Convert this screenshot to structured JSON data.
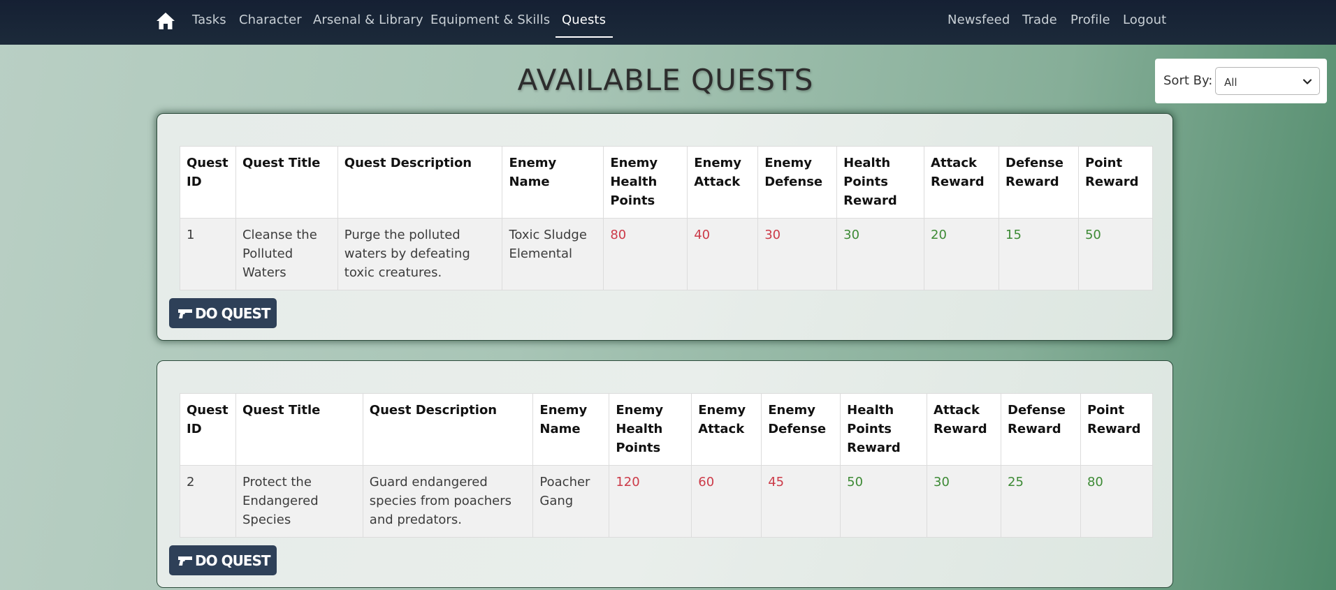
{
  "nav": {
    "left": [
      {
        "label": "Tasks"
      },
      {
        "label": "Character"
      },
      {
        "label": "Arsenal & Library"
      },
      {
        "label": "Equipment & Skills"
      },
      {
        "label": "Quests"
      }
    ],
    "right": [
      {
        "label": "Newsfeed"
      },
      {
        "label": "Trade"
      },
      {
        "label": "Profile"
      },
      {
        "label": "Logout"
      }
    ],
    "active": "Quests"
  },
  "page": {
    "title": "AVAILABLE QUESTS"
  },
  "sort": {
    "label": "Sort By:",
    "value": "All"
  },
  "table_headers": [
    "Quest ID",
    "Quest Title",
    "Quest Description",
    "Enemy Name",
    "Enemy Health Points",
    "Enemy Attack",
    "Enemy Defense",
    "Health Points Reward",
    "Attack Reward",
    "Defense Reward",
    "Point Reward"
  ],
  "quests": [
    {
      "id": "1",
      "title": "Cleanse the Polluted Waters",
      "description": "Purge the polluted waters by defeating toxic creatures.",
      "enemy_name": "Toxic Sludge Elemental",
      "enemy_hp": "80",
      "enemy_attack": "40",
      "enemy_defense": "30",
      "hp_reward": "30",
      "attack_reward": "20",
      "defense_reward": "15",
      "point_reward": "50",
      "button": "DO QUEST"
    },
    {
      "id": "2",
      "title": "Protect the Endangered Species",
      "description": "Guard endangered species from poachers and predators.",
      "enemy_name": "Poacher Gang",
      "enemy_hp": "120",
      "enemy_attack": "60",
      "enemy_defense": "45",
      "hp_reward": "50",
      "attack_reward": "30",
      "defense_reward": "25",
      "point_reward": "80",
      "button": "DO QUEST"
    }
  ],
  "colors": {
    "enemy_stat": "#cc3a48",
    "reward_stat": "#3d8a35",
    "navbar": "#152033",
    "button": "#2e4058"
  },
  "icons": {
    "home": "home-icon",
    "button": "gun-icon",
    "select": "chevron-down-icon"
  }
}
